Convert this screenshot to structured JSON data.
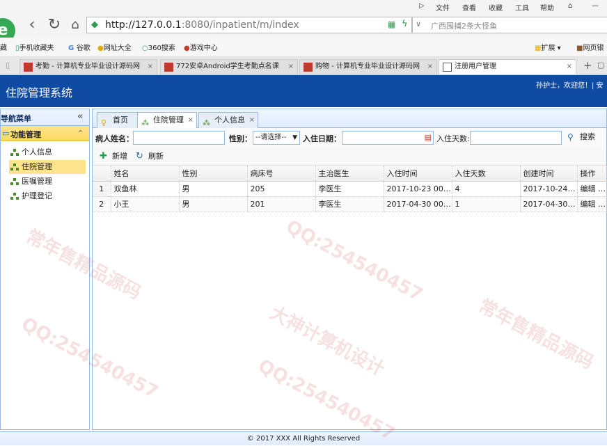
{
  "browser": {
    "menu": [
      "文件",
      "查看",
      "收藏",
      "工具",
      "帮助"
    ],
    "url_host": "http://127.0.0.1",
    "url_rest": ":8080/inpatient/m/index",
    "search_placeholder": "广西围捕2条大怪鱼",
    "bookmarks": [
      "藏",
      "手机收藏夹",
      "谷歌",
      "网址大全",
      "360搜索",
      "游戏中心",
      "扩展",
      "网页银"
    ],
    "tabs": [
      {
        "title": "考勤 - 计算机专业毕业设计源码网"
      },
      {
        "title": "772安卓Android学生考勤点名课"
      },
      {
        "title": "购物 - 计算机专业毕业设计源码网"
      },
      {
        "title": "注册用户管理"
      }
    ]
  },
  "app": {
    "title": "住院管理系统",
    "welcome": "孙护士，欢迎您！| 安"
  },
  "sidebar": {
    "header": "导航菜单",
    "group": "功能管理",
    "items": [
      {
        "label": "个人信息"
      },
      {
        "label": "住院管理"
      },
      {
        "label": "医嘱管理"
      },
      {
        "label": "护理登记"
      }
    ]
  },
  "page_tabs": [
    {
      "label": "首页"
    },
    {
      "label": "住院管理"
    },
    {
      "label": "个人信息"
    }
  ],
  "filter": {
    "name_label": "病人姓名：",
    "gender_label": "性别：",
    "gender_value": "--请选择--",
    "date_label": "入住日期：",
    "days_label": "入住天数:",
    "search_label": "搜索"
  },
  "toolbar": {
    "add_label": "新增",
    "refresh_label": "刷新"
  },
  "table": {
    "columns": [
      "姓名",
      "性别",
      "病床号",
      "主治医生",
      "入住时间",
      "入住天数",
      "创建时间",
      "操作"
    ],
    "rows": [
      {
        "num": "1",
        "cells": [
          "双鱼林",
          "男",
          "205",
          "李医生",
          "2017-10-23 00:...",
          "4",
          "2017-10-24 ...",
          "编辑 | ..."
        ]
      },
      {
        "num": "2",
        "cells": [
          "小王",
          "男",
          "201",
          "李医生",
          "2017-04-30 00:...",
          "1",
          "2017-04-30 ...",
          "编辑 | ..."
        ]
      }
    ]
  },
  "footer": "© 2017 XXX All Rights Reserved",
  "watermark": [
    "常年售精品源码",
    "QQ:254540457",
    "大神计算机设计"
  ],
  "colors": {
    "header_blue": "#0f4aa3",
    "selected_yellow": "#ffe48d",
    "border_blue": "#95b8e7"
  }
}
